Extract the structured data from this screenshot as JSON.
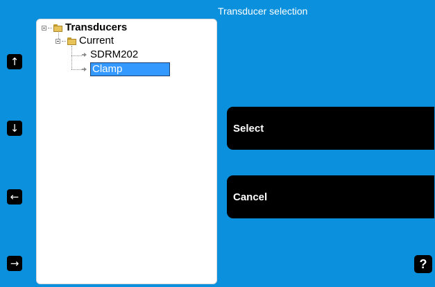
{
  "window": {
    "title": "Transducer selection"
  },
  "tree": {
    "root": {
      "label": "Transducers",
      "icon": "folder-icon",
      "expanded": true
    },
    "group": {
      "label": "Current",
      "icon": "folder-icon",
      "expanded": true
    },
    "items": [
      {
        "label": "SDRM202",
        "icon": "leaf-arrow-icon",
        "selected": false
      },
      {
        "label": "Clamp",
        "icon": "leaf-arrow-icon",
        "selected": true
      }
    ]
  },
  "nav": {
    "up": {
      "glyph": "↑",
      "icon": "arrow-up-icon"
    },
    "down": {
      "glyph": "↓",
      "icon": "arrow-down-icon"
    },
    "left": {
      "glyph": "←",
      "icon": "arrow-left-icon"
    },
    "right": {
      "glyph": "→",
      "icon": "arrow-right-icon"
    }
  },
  "actions": {
    "select_label": "Select",
    "cancel_label": "Cancel"
  },
  "help": {
    "glyph": "?",
    "icon": "help-icon"
  },
  "colors": {
    "background": "#0a90dc",
    "panel": "#ffffff",
    "button": "#000000",
    "selection": "#3399ff",
    "text_light": "#ffffff"
  }
}
